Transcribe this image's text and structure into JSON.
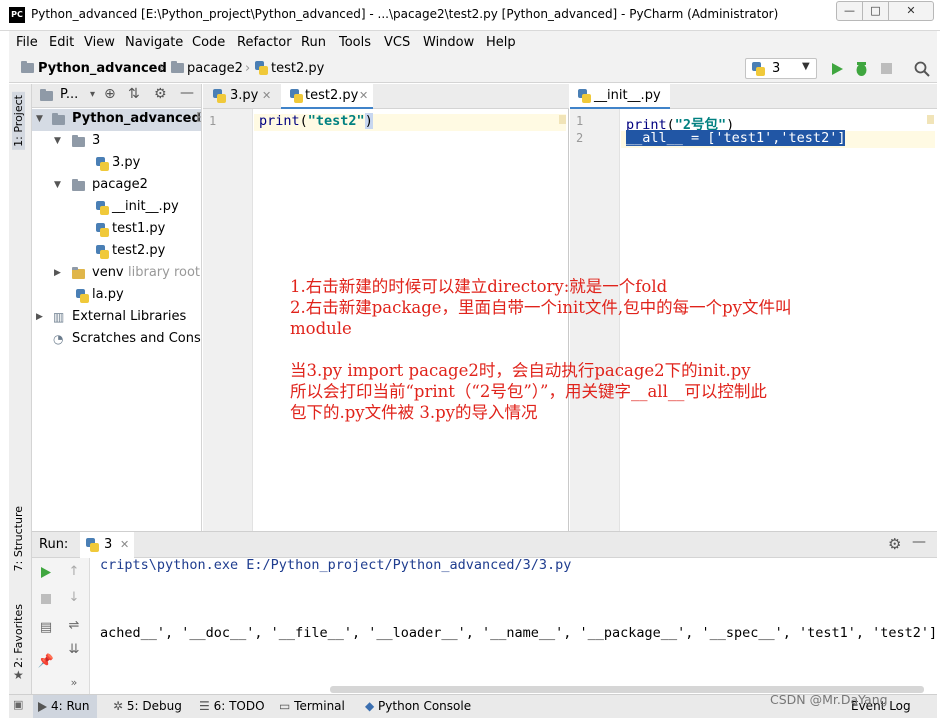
{
  "window": {
    "title": "Python_advanced [E:\\Python_project\\Python_advanced] - ...\\pacage2\\test2.py [Python_advanced] - PyCharm (Administrator)",
    "app_logo": "PC",
    "minimize": "—",
    "maximize": "□",
    "close": "✕"
  },
  "menu": [
    "File",
    "Edit",
    "View",
    "Navigate",
    "Code",
    "Refactor",
    "Run",
    "Tools",
    "VCS",
    "Window",
    "Help"
  ],
  "breadcrumb": [
    "Python_advanced",
    "pacage2",
    "test2.py"
  ],
  "toolbar": {
    "run_config": "3"
  },
  "sidebar": {
    "project_tab": "1: Project",
    "structure_tab": "7: Structure",
    "favorites_tab": "2: Favorites"
  },
  "project": {
    "header_label": "P...",
    "root": "Python_advanced",
    "root_suffix": "E",
    "tree": {
      "folder_3": "3",
      "file_3py": "3.py",
      "folder_pacage2": "pacage2",
      "file_init": "__init__.py",
      "file_test1": "test1.py",
      "file_test2": "test2.py",
      "folder_venv": "venv",
      "venv_note": "library root",
      "file_la": "la.py",
      "external": "External Libraries",
      "scratches": "Scratches and Conso"
    }
  },
  "editor_left": {
    "tabs": [
      "3.py",
      "test2.py"
    ],
    "line_numbers": [
      "1"
    ],
    "code": {
      "l1_func": "print",
      "l1_open": "(",
      "l1_str": "\"test2\"",
      "l1_close": ")"
    }
  },
  "editor_right": {
    "tabs": [
      "__init__.py"
    ],
    "line_numbers": [
      "1",
      "2"
    ],
    "code": {
      "l1_func": "print",
      "l1_open": "(",
      "l1_str": "\"2号包\"",
      "l1_close": ")",
      "l2": "__all__ = ['test1','test2']"
    }
  },
  "annotation": {
    "line1": "1.右击新建的时候可以建立directory:就是一个fold",
    "line2": "2.右击新建package，里面自带一个init文件,包中的每一个py文件叫",
    "line3": "module",
    "line4": "",
    "line5": "当3.py import pacage2时，会自动执行pacage2下的init.py",
    "line6": "所以会打印当前“print（“2号包”）”，用关键字__all__可以控制此",
    "line7": "包下的.py文件被 3.py的导入情况"
  },
  "run": {
    "label": "Run:",
    "tab": "3",
    "console": {
      "line1": "cripts\\python.exe E:/Python_project/Python_advanced/3/3.py",
      "line2": "ached__', '__doc__', '__file__', '__loader__', '__name__', '__package__', '__spec__', 'test1', 'test2']"
    }
  },
  "bottom_tabs": {
    "run": "4: Run",
    "debug": "5: Debug",
    "todo": "6: TODO",
    "terminal": "Terminal",
    "python_console": "Python Console",
    "event_log": "Event Log"
  },
  "watermark": "CSDN @Mr.DaYang"
}
